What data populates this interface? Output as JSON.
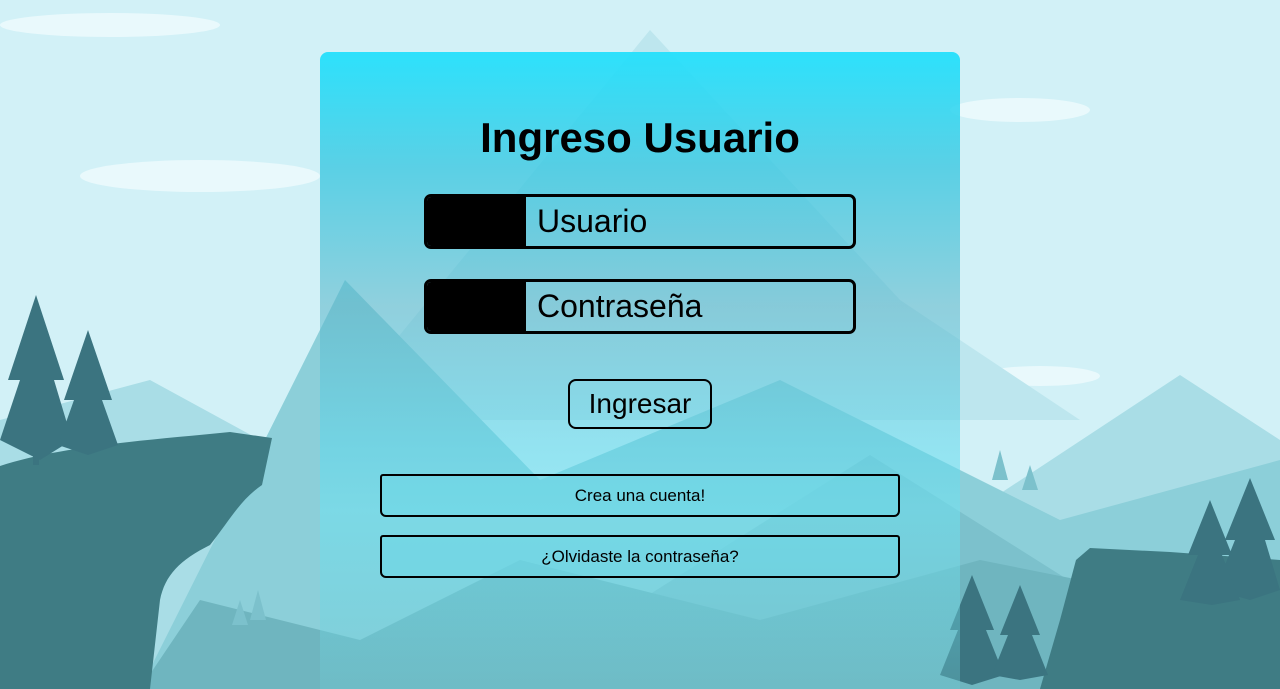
{
  "login": {
    "title": "Ingreso Usuario",
    "username_placeholder": "Usuario",
    "password_placeholder": "Contraseña",
    "submit_label": "Ingresar",
    "create_account_label": "Crea una cuenta!",
    "forgot_password_label": "¿Olvidaste la contraseña?"
  },
  "colors": {
    "card_top": "#24e0fc",
    "sky": "#cfeff5",
    "mountain_far": "#9fdbe4",
    "mountain_mid": "#7ec7d2",
    "cliff": "#3f7c84",
    "pine": "#3b7480"
  }
}
